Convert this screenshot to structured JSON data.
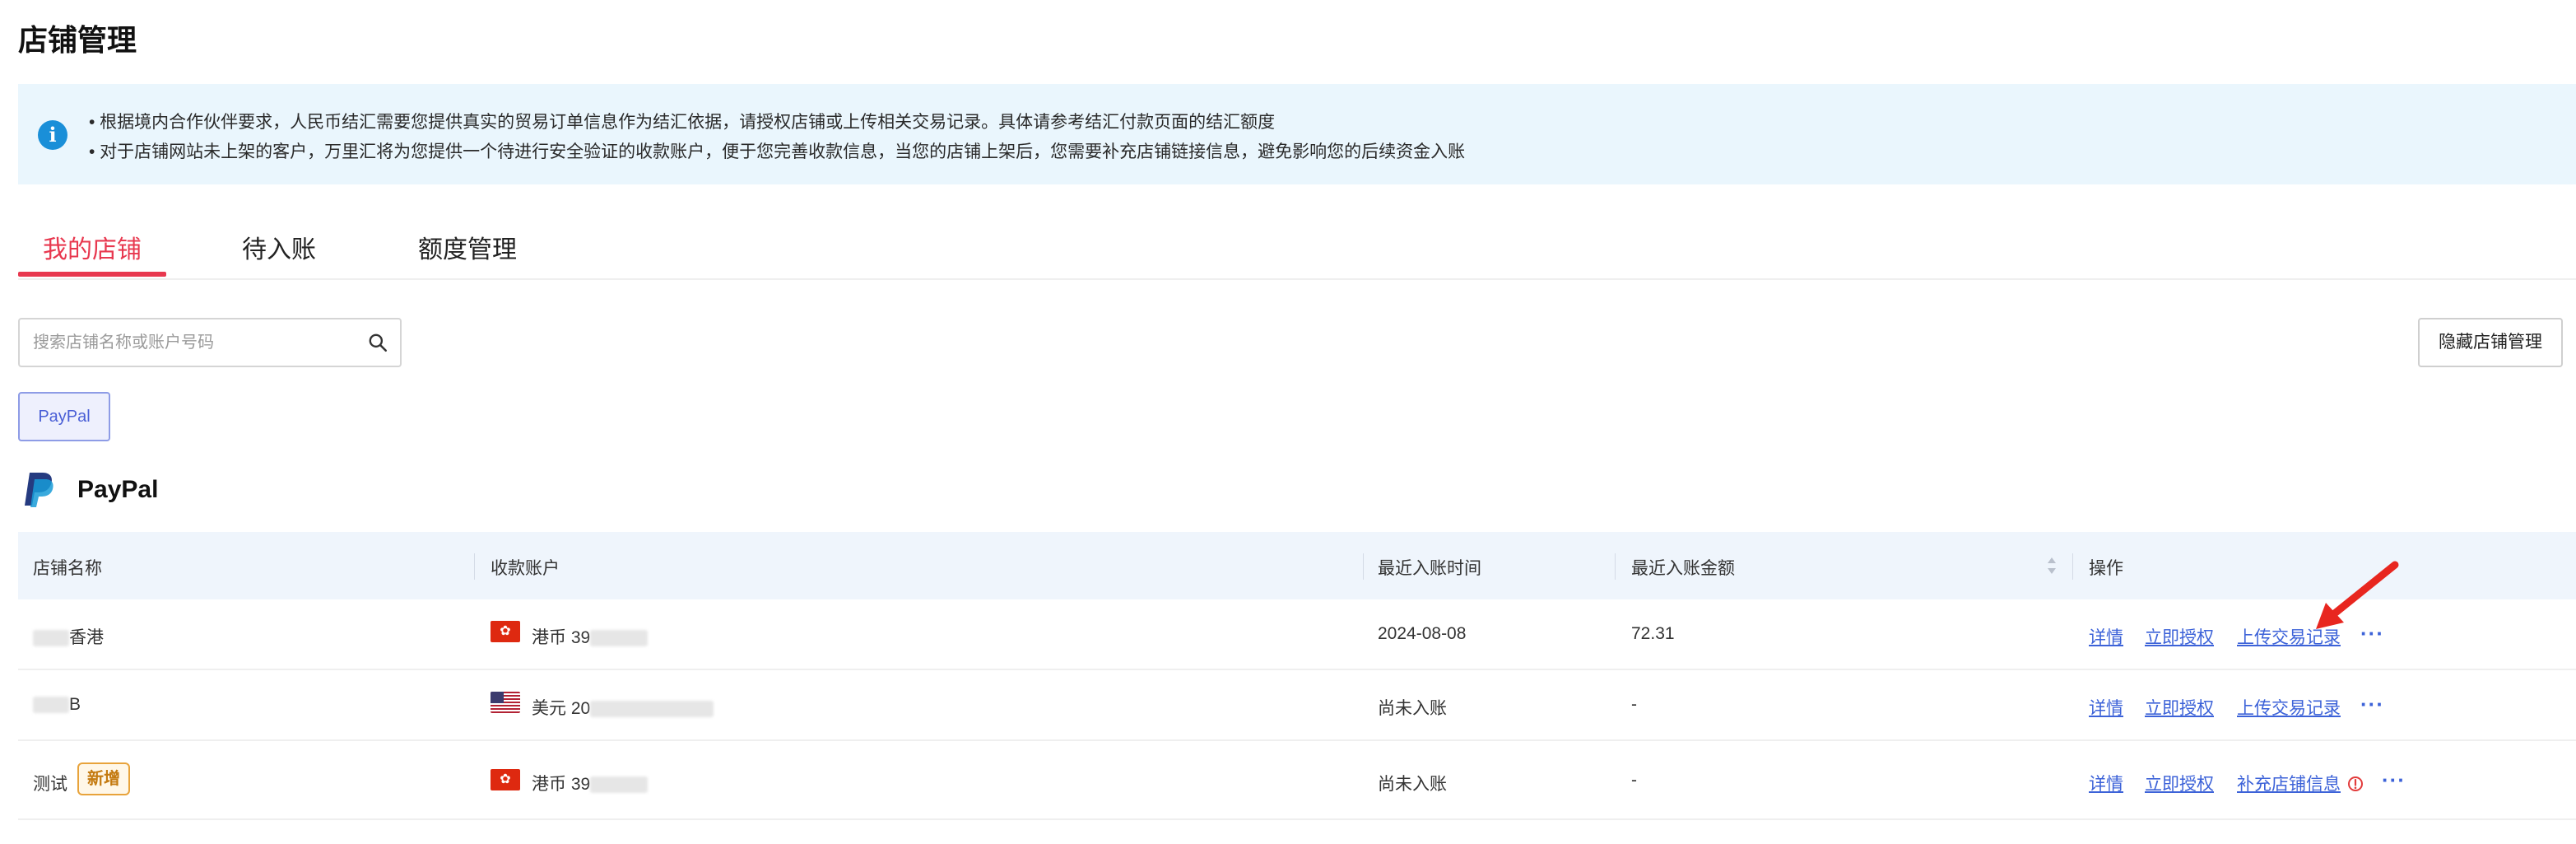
{
  "page_title": "店铺管理",
  "notice": {
    "icon": "info-icon",
    "line1": "• 根据境内合作伙伴要求，人民币结汇需要您提供真实的贸易订单信息作为结汇依据，请授权店铺或上传相关交易记录。具体请参考结汇付款页面的结汇额度",
    "line2": "• 对于店铺网站未上架的客户，万里汇将为您提供一个待进行安全验证的收款账户，便于您完善收款信息，当您的店铺上架后，您需要补充店铺链接信息，避免影响您的后续资金入账"
  },
  "tabs": [
    {
      "label": "我的店铺",
      "active": true
    },
    {
      "label": "待入账",
      "active": false
    },
    {
      "label": "额度管理",
      "active": false
    }
  ],
  "search": {
    "placeholder": "搜索店铺名称或账户号码",
    "value": ""
  },
  "hide_store_button": "隐藏店铺管理",
  "filter_chip": "PayPal",
  "section": {
    "title": "PayPal",
    "logo": "paypal-logo"
  },
  "table": {
    "columns": [
      "店铺名称",
      "收款账户",
      "最近入账时间",
      "最近入账金额",
      "操作"
    ],
    "rows": [
      {
        "store_visible": "香港",
        "currency": "港币",
        "account_prefix": "39",
        "flag": "hk-flag",
        "last_time": "2024-08-08",
        "last_amount": "72.31",
        "actions": [
          "详情",
          "立即授权",
          "上传交易记录"
        ]
      },
      {
        "store_visible": "B",
        "currency": "美元",
        "account_prefix": "20",
        "flag": "us-flag",
        "last_time": "尚未入账",
        "last_amount": "-",
        "actions": [
          "详情",
          "立即授权",
          "上传交易记录"
        ]
      },
      {
        "store_visible": "测试",
        "badge": "新增",
        "currency": "港币",
        "account_prefix": "39",
        "flag": "hk-flag",
        "last_time": "尚未入账",
        "last_amount": "-",
        "actions": [
          "详情",
          "立即授权",
          "补充店铺信息"
        ]
      }
    ],
    "more_label": "···"
  },
  "colors": {
    "accent_red": "#e8384f",
    "link_blue": "#3c62d8",
    "notice_bg": "#eaf6fd",
    "badge_orange": "#e8a33b"
  }
}
